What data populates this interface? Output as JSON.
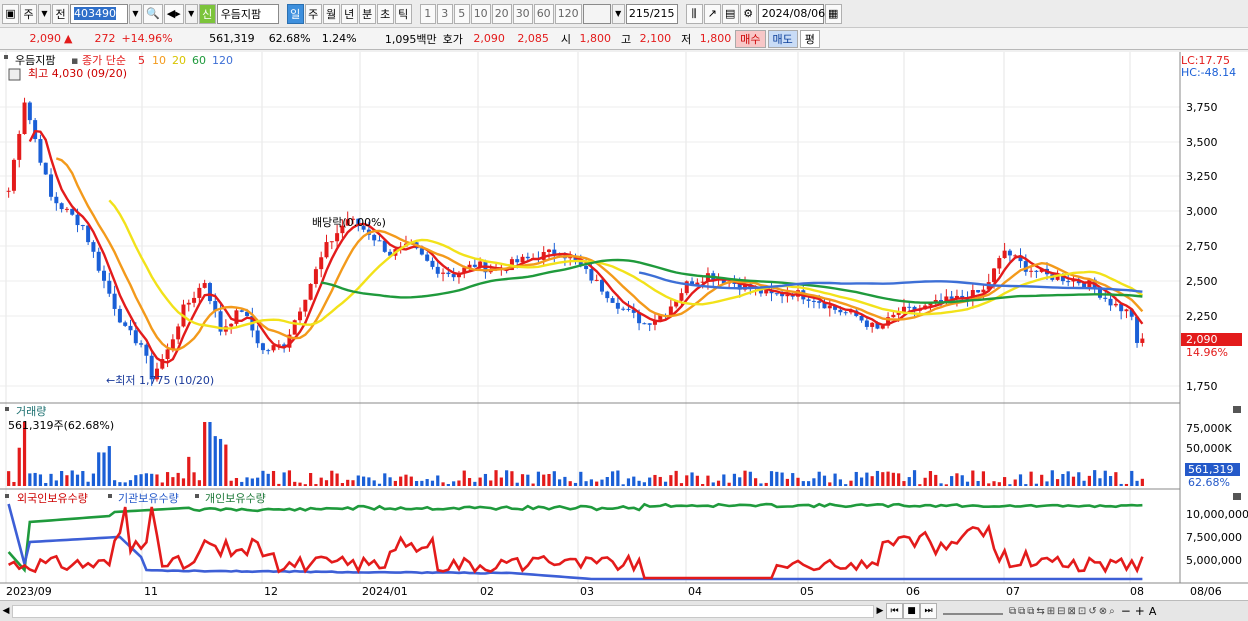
{
  "toolbar": {
    "type": "주",
    "pos": "전",
    "code": "403490",
    "name": "우듬지팜",
    "sin": "신",
    "periods": [
      "일",
      "주",
      "월",
      "년",
      "분",
      "초",
      "틱"
    ],
    "nums": [
      "1",
      "3",
      "5",
      "10",
      "20",
      "30",
      "60",
      "120"
    ],
    "count": "215/215",
    "date": "2024/08/06"
  },
  "quote": {
    "price": "2,090",
    "change": "272",
    "pct": "+14.96%",
    "vol": "561,319",
    "turnover": "62.68%",
    "vr": "1.24%",
    "amount": "1,095백만",
    "hoga_label": "호가",
    "hoga1": "2,090",
    "hoga2": "2,085",
    "open_label": "시",
    "open": "1,800",
    "high_label": "고",
    "high": "2,100",
    "low_label": "저",
    "low": "1,800",
    "buy": "매수",
    "sell": "매도",
    "avg": "평"
  },
  "price_panel": {
    "name": "우듬지팜",
    "ma_label": "종가 단순",
    "ma_periods": [
      "5",
      "10",
      "20",
      "60",
      "120"
    ],
    "hi_note": "최고 4,030 (09/20)",
    "lo_note": "←최저 1,775 (10/20)",
    "div_note": "배당락(0.00%)",
    "lc": "LC:17.75",
    "hc": "HC:-48.14",
    "price_tag": "2,090",
    "pct_tag": "14.96%",
    "y_ticks": [
      "3,750",
      "3,500",
      "3,250",
      "3,000",
      "2,750",
      "2,500",
      "2,250",
      "1,750"
    ]
  },
  "vol_panel": {
    "title": "거래량",
    "note": "561,319주(62.68%)",
    "y_ticks": [
      "75,000K",
      "50,000K",
      "25,000K"
    ],
    "tag": "561,319",
    "tag2": "62.68%"
  },
  "hold_panel": {
    "leg1": "외국인보유수량",
    "leg2": "기관보유수량",
    "leg3": "개인보유수량",
    "y_ticks": [
      "10,000,000",
      "7,500,000",
      "5,000,000"
    ]
  },
  "x_labels": [
    "2023/09",
    "11",
    "12",
    "2024/01",
    "02",
    "03",
    "04",
    "05",
    "06",
    "07",
    "08",
    "08/06"
  ],
  "colors": {
    "up": "#e31b1b",
    "down": "#1a5fd6",
    "ma5": "#e31b1b",
    "ma10": "#f39a1b",
    "ma20": "#f2e21a",
    "ma60": "#1f9a3c",
    "ma120": "#3d6fd6"
  }
}
